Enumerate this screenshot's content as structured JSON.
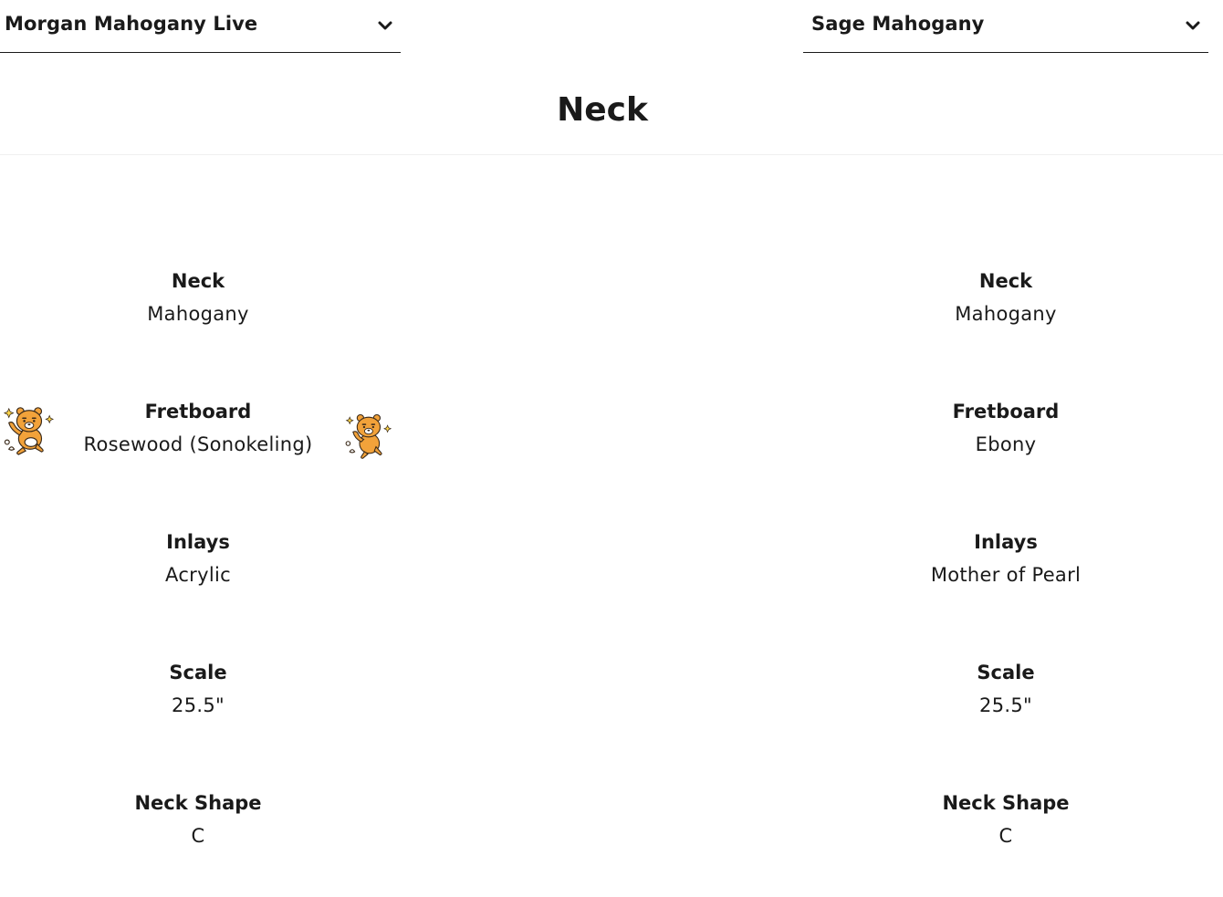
{
  "selectors": {
    "left": {
      "value": "Morgan Mahogany Live"
    },
    "right": {
      "value": "Sage Mahogany"
    }
  },
  "section": {
    "title": "Neck"
  },
  "left_specs": [
    {
      "label": "Neck",
      "value": "Mahogany"
    },
    {
      "label": "Fretboard",
      "value": "Rosewood (Sonokeling)"
    },
    {
      "label": "Inlays",
      "value": "Acrylic"
    },
    {
      "label": "Scale",
      "value": "25.5\""
    },
    {
      "label": "Neck Shape",
      "value": "C"
    }
  ],
  "right_specs": [
    {
      "label": "Neck",
      "value": "Mahogany"
    },
    {
      "label": "Fretboard",
      "value": "Ebony"
    },
    {
      "label": "Inlays",
      "value": "Mother of Pearl"
    },
    {
      "label": "Scale",
      "value": "25.5\""
    },
    {
      "label": "Neck Shape",
      "value": "C"
    }
  ],
  "icons": {
    "dropdown": "chevron-down-icon",
    "sticker": "bear-sticker-icon"
  },
  "colors": {
    "text": "#1a1a1a",
    "sticker_fur": "#f2a23a",
    "background": "#ffffff"
  }
}
